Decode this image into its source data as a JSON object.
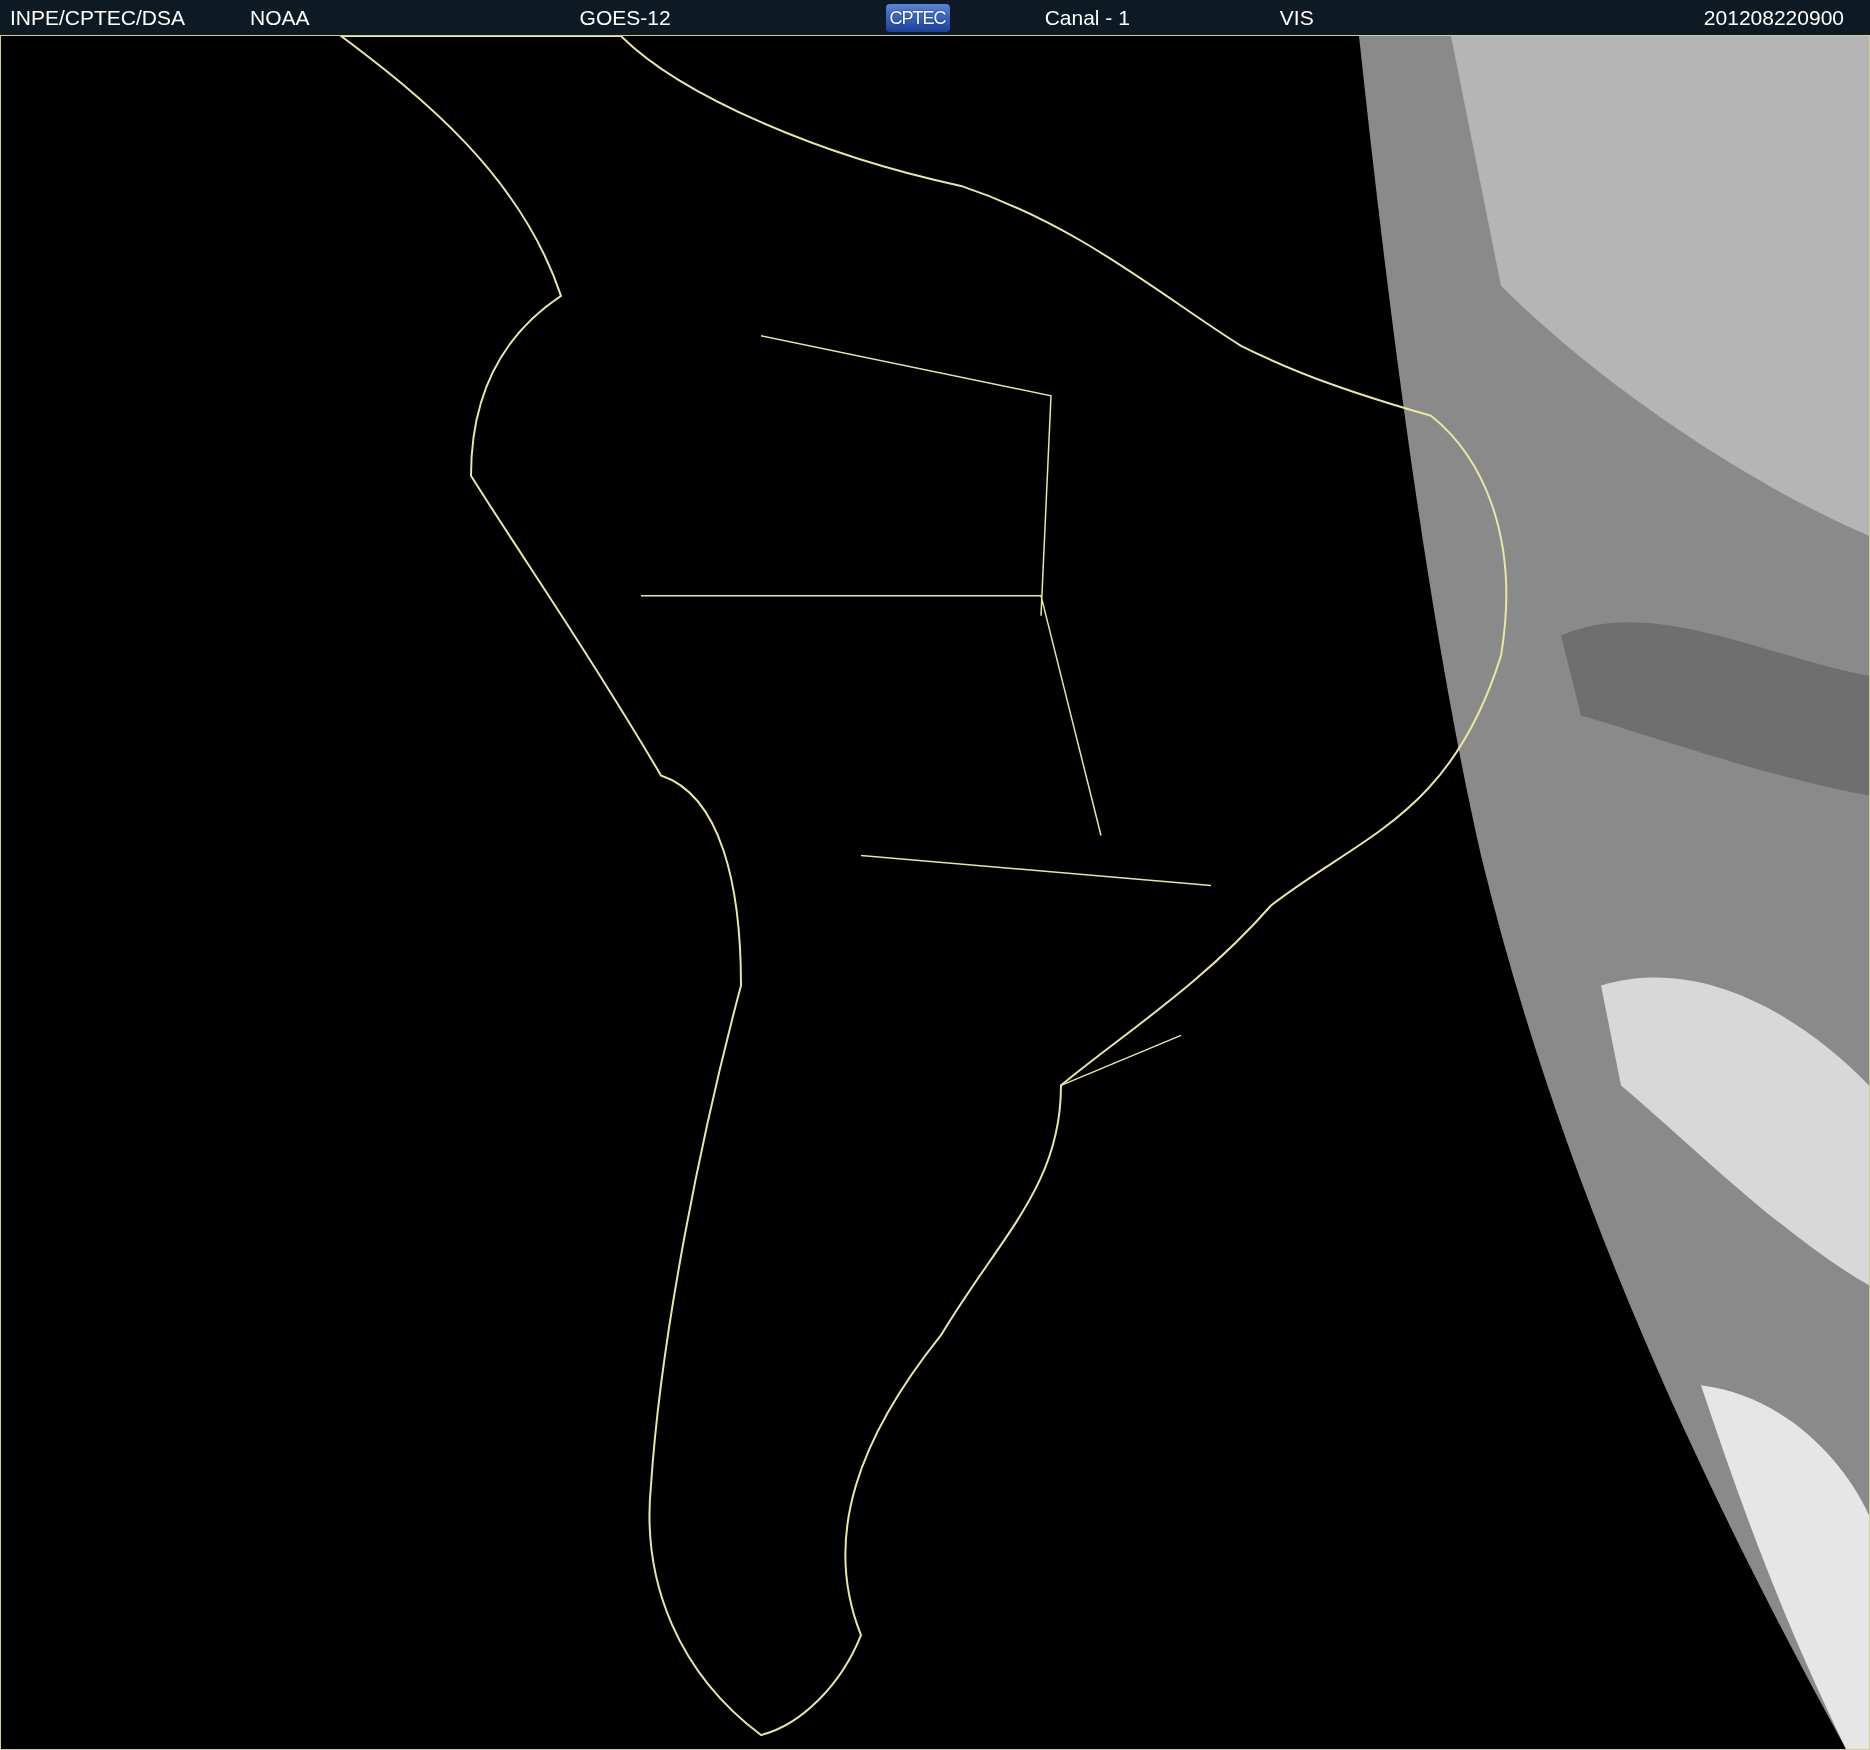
{
  "header": {
    "institution": "INPE/CPTEC/DSA",
    "agency": "NOAA",
    "satellite": "GOES-12",
    "logo": "CPTEC",
    "channel": "Canal - 1",
    "band": "VIS",
    "timestamp": "201208220900"
  }
}
